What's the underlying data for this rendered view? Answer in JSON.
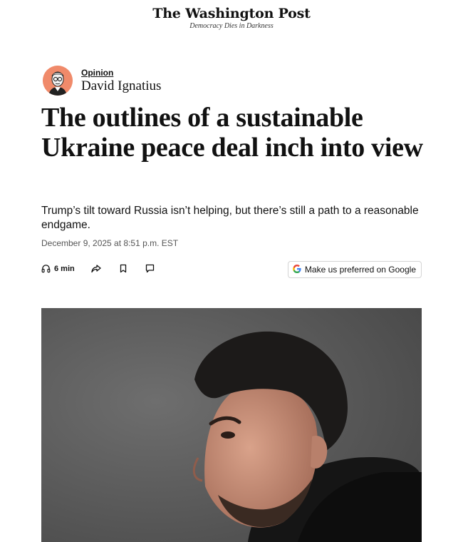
{
  "masthead": {
    "logo_text": "The Washington Post",
    "tagline": "Democracy Dies in Darkness"
  },
  "byline": {
    "section": "Opinion",
    "author": "David Ignatius",
    "avatar_color": "#f08a6a"
  },
  "article": {
    "headline": "The outlines of a sustainable Ukraine peace deal inch into view",
    "dek": "Trump’s tilt toward Russia isn’t helping, but there’s still a path to a reasonable endgame.",
    "dateline": "December 9, 2025 at 8:51 p.m. EST"
  },
  "toolbar": {
    "listen_label": "6 min",
    "listen_icon": "headphones-icon",
    "share_icon": "share-icon",
    "save_icon": "bookmark-icon",
    "comment_icon": "comment-icon",
    "google_label": "Make us preferred on Google",
    "google_icon_letter": "G"
  },
  "lead_image": {
    "subject": "photo",
    "background_color": "#5a5a5a"
  }
}
